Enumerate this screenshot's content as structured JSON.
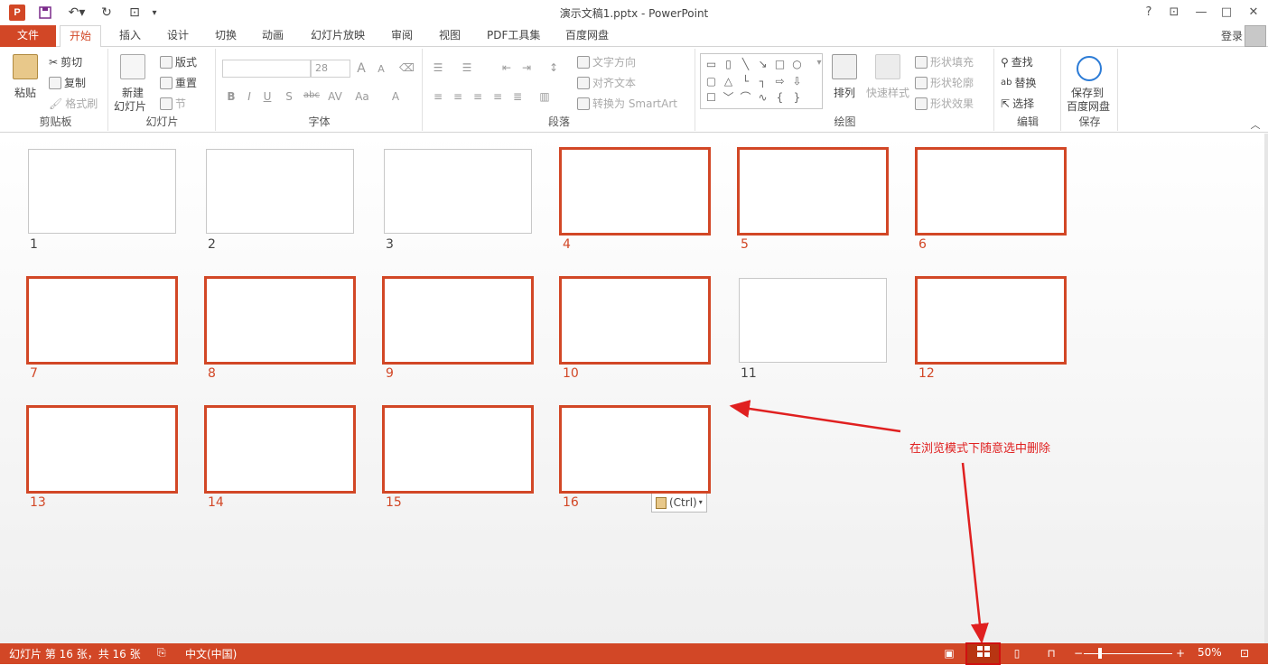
{
  "window": {
    "title": "演示文稿1.pptx - PowerPoint",
    "app_icon": "P",
    "help": "?"
  },
  "tabs": [
    "文件",
    "开始",
    "插入",
    "设计",
    "切换",
    "动画",
    "幻灯片放映",
    "审阅",
    "视图",
    "PDF工具集",
    "百度网盘"
  ],
  "login": "登录",
  "ribbon": {
    "clipboard": {
      "paste": "粘贴",
      "cut": "剪切",
      "copy": "复制",
      "format_painter": "格式刷",
      "label": "剪贴板"
    },
    "slides": {
      "new_slide_line1": "新建",
      "new_slide_line2": "幻灯片",
      "layout": "版式",
      "reset": "重置",
      "section": "节",
      "label": "幻灯片"
    },
    "font": {
      "font_size": "28",
      "bold": "B",
      "italic": "I",
      "underline": "U",
      "shadow": "S",
      "strike": "abc",
      "spacing": "AV",
      "case": "Aa",
      "color": "A",
      "grow": "A",
      "shrink": "A",
      "label": "字体"
    },
    "paragraph": {
      "text_direction": "文字方向",
      "align_text": "对齐文本",
      "smartart": "转换为 SmartArt",
      "label": "段落"
    },
    "drawing": {
      "arrange": "排列",
      "quick_styles": "快速样式",
      "shape_fill": "形状填充",
      "shape_outline": "形状轮廓",
      "shape_effects": "形状效果",
      "label": "绘图"
    },
    "editing": {
      "find": "查找",
      "replace": "替换",
      "select": "选择",
      "label": "编辑"
    },
    "save": {
      "line1": "保存到",
      "line2": "百度网盘",
      "label": "保存"
    }
  },
  "slides": [
    {
      "num": "1",
      "selected": false
    },
    {
      "num": "2",
      "selected": false
    },
    {
      "num": "3",
      "selected": false
    },
    {
      "num": "4",
      "selected": true
    },
    {
      "num": "5",
      "selected": true
    },
    {
      "num": "6",
      "selected": true
    },
    {
      "num": "7",
      "selected": true
    },
    {
      "num": "8",
      "selected": true
    },
    {
      "num": "9",
      "selected": true
    },
    {
      "num": "10",
      "selected": true
    },
    {
      "num": "11",
      "selected": false
    },
    {
      "num": "12",
      "selected": true
    },
    {
      "num": "13",
      "selected": true
    },
    {
      "num": "14",
      "selected": true
    },
    {
      "num": "15",
      "selected": true
    },
    {
      "num": "16",
      "selected": true
    }
  ],
  "paste_options": "(Ctrl)",
  "annotation": "在浏览模式下随意选中删除",
  "status": {
    "slide_info": "幻灯片 第 16 张，共 16 张",
    "language": "中文(中国)",
    "zoom": "50%"
  },
  "colors": {
    "accent": "#d24726",
    "annotation": "#e02020"
  }
}
